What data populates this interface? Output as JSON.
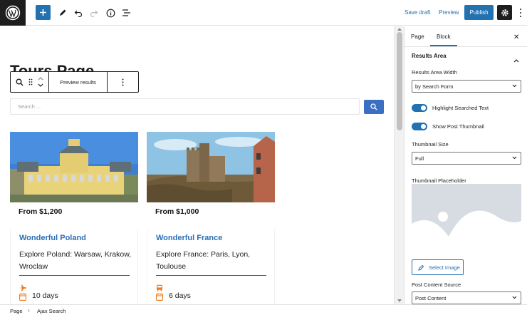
{
  "topbar": {
    "save_draft": "Save draft",
    "preview": "Preview",
    "publish": "Publish"
  },
  "editor": {
    "page_title": "Tours Page",
    "block_toolbar": {
      "preview_results": "Preview results"
    },
    "search": {
      "placeholder": "Search ..."
    },
    "cards": [
      {
        "price": "From $1,200",
        "title": "Wonderful Poland",
        "description": "Explore Poland: Warsaw, Krakow, Wroclaw",
        "duration": "10 days",
        "icon": "plane-icon"
      },
      {
        "price": "From $1,000",
        "title": "Wonderful France",
        "description": "Explore France: Paris, Lyon, Toulouse",
        "duration": "6 days",
        "icon": "bus-icon"
      }
    ]
  },
  "sidebar": {
    "tabs": [
      "Page",
      "Block"
    ],
    "active_tab": "Block",
    "section_title": "Results Area",
    "results_width_label": "Results Area Width",
    "results_width_value": "by Search Form",
    "highlight_label": "Highlight Searched Text",
    "highlight_on": true,
    "thumbnail_label": "Show Post Thumbnail",
    "thumbnail_on": true,
    "thumb_size_label": "Thumbnail Size",
    "thumb_size_value": "Full",
    "placeholder_label": "Thumbnail Placeholder",
    "select_image": "Select Image",
    "content_source_label": "Post Content Source",
    "content_source_value": "Post Content"
  },
  "breadcrumb": [
    "Page",
    "Ajax Search"
  ],
  "colors": {
    "accent": "#2271b1",
    "card_title": "#2a6fb6",
    "card_icon": "#f07a1a"
  }
}
